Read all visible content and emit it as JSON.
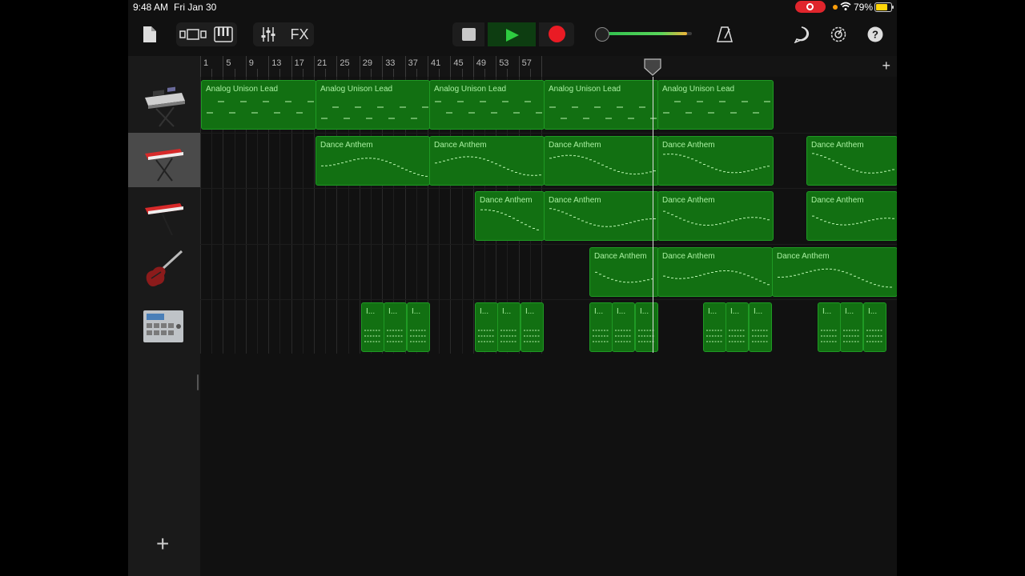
{
  "status_bar": {
    "time": "9:48 AM",
    "date": "Fri Jan 30",
    "battery": "79%",
    "battery_level": 0.79
  },
  "toolbar": {
    "fx_label": "FX",
    "icons": [
      "document-icon",
      "tracks-view-icon",
      "keyboard-icon",
      "mixer-icon",
      "fx-button",
      "stop-icon",
      "play-icon",
      "record-icon",
      "metronome-icon",
      "loop-browser-icon",
      "settings-icon",
      "help-icon"
    ],
    "master_volume": 0.95,
    "colors": {
      "play": "#2ecc40",
      "record": "#ea1b24",
      "region": "#127012"
    }
  },
  "ruler": {
    "bars": [
      "1",
      "5",
      "9",
      "13",
      "17",
      "21",
      "25",
      "29",
      "33",
      "37",
      "41",
      "45",
      "49",
      "53",
      "57"
    ]
  },
  "playhead_bar": "41",
  "tracks": [
    {
      "name": "synth-lead",
      "icon": "synth-icon",
      "selected": false
    },
    {
      "name": "keyboard-red-1",
      "icon": "red-keyboard-icon",
      "selected": true
    },
    {
      "name": "keyboard-red-2",
      "icon": "red-keyboard-icon",
      "selected": false
    },
    {
      "name": "electric-guitar",
      "icon": "guitar-icon",
      "selected": false
    },
    {
      "name": "drum-machine",
      "icon": "beat-sequencer-icon",
      "selected": false
    }
  ],
  "regions": {
    "track1": [
      "Analog Unison Lead",
      "Analog Unison Lead",
      "Analog Unison Lead",
      "Analog Unison Lead",
      "Analog Unison Lead"
    ],
    "track2": [
      "Dance Anthem",
      "Dance Anthem",
      "Dance Anthem",
      "Dance Anthem",
      "Dance Anthem"
    ],
    "track3": [
      "Dance Anthem",
      "Dance Anthem",
      "Dance Anthem",
      "Dance Anthem"
    ],
    "track4": [
      "Dance Anthem",
      "Dance Anthem",
      "Dance Anthem"
    ],
    "track5_label": "I..."
  }
}
